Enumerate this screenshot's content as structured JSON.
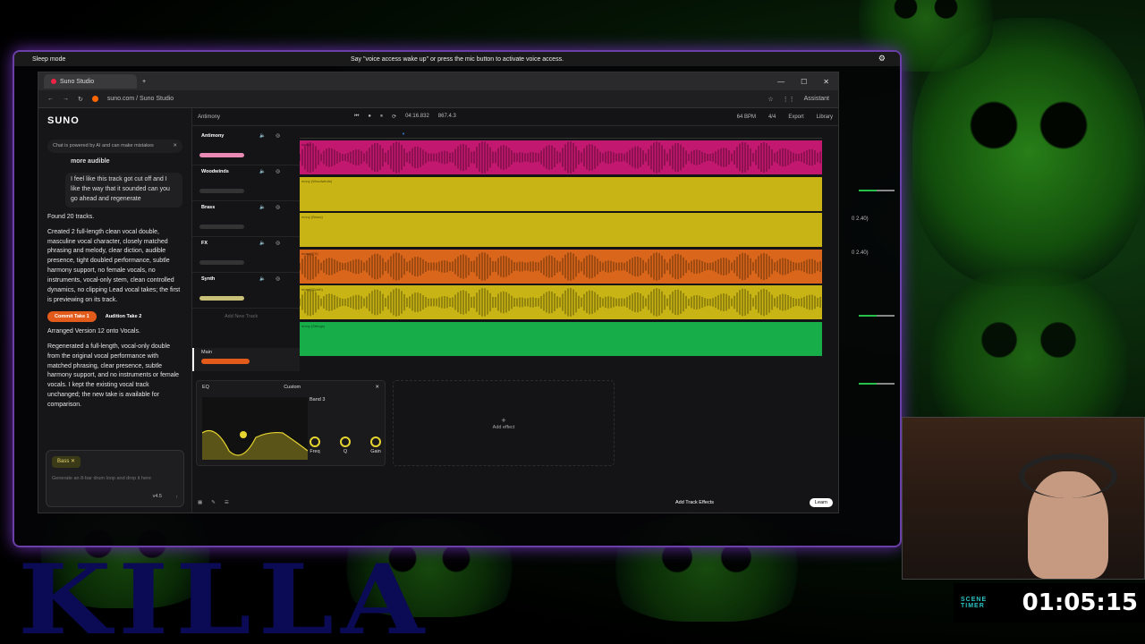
{
  "voice_access": {
    "status": "Sleep mode",
    "message": "Say \"voice access wake up\" or press the mic button to activate voice access."
  },
  "browser": {
    "tab_title": "Suno Studio",
    "url": "suno.com / Suno Studio",
    "assistant_label": "Assistant"
  },
  "chat": {
    "logo": "SUNO",
    "notice": "Chat is powered by AI and can make mistakes",
    "prev_fragment": "more audible",
    "user_message": "I feel like this track got cut off and I like the way that it sounded can you go ahead and regenerate",
    "found": "Found 20 tracks.",
    "created": "Created 2 full-length clean vocal double, masculine vocal character, closely matched phrasing and melody, clear diction, audible presence, tight doubled performance, subtle harmony support, no female vocals, no instruments, vocal-only stem, clean controlled dynamics, no clipping Lead vocal takes; the first is previewing on its track.",
    "commit_btn": "Commit Take 1",
    "audition_btn": "Audition Take 2",
    "arranged": "Arranged Version 12 onto Vocals.",
    "regenerated": "Regenerated a full-length, vocal-only double from the original vocal performance with matched phrasing, clear presence, subtle harmony support, and no instruments or female vocals. I kept the existing vocal track unchanged; the new take is available for comparison.",
    "chip": "Bass",
    "placeholder": "Generate an 8-bar drum loop and drop it here",
    "version": "v4.5"
  },
  "studio": {
    "project": "Antimony",
    "time": "04:16.832",
    "bpm_display": "867.4.3",
    "bpm": "64 BPM",
    "meter": "4/4",
    "export": "Export",
    "library": "Library",
    "tracks": [
      {
        "name": "Antimony",
        "color": "#c2186f",
        "clip": "mony"
      },
      {
        "name": "Woodwinds",
        "color": "#c8b415",
        "clip": "mony (Woodwinds)"
      },
      {
        "name": "Brass",
        "color": "#c8b415",
        "clip": "mony (Brass)"
      },
      {
        "name": "FX",
        "color": "#d9661a",
        "clip": "mony (FX)"
      },
      {
        "name": "Synth",
        "color": "#c8b415",
        "clip": "mony (Synth)"
      },
      {
        "name": "",
        "color": "#17ad49",
        "clip": "mony (Strings)"
      }
    ],
    "add_track": "Add New Track",
    "master": "Main",
    "eq": {
      "title": "EQ",
      "preset": "Custom",
      "band": "Band 3",
      "knobs": [
        "Freq",
        "Q",
        "Gain"
      ]
    },
    "add_effect": "Add effect",
    "learn": "Learn",
    "add_track_effects": "Add Track Effects"
  },
  "right_panel": {
    "values": [
      "0 2.40)",
      "0 2.40)"
    ]
  },
  "timer": {
    "label": "SCENE TIMER",
    "value": "01:05:15"
  },
  "background_text": "KILLA",
  "colors": {
    "accent_orange": "#e25b1a",
    "frame_purple": "#6b3fa8",
    "timer_cyan": "#2bc4c4"
  }
}
